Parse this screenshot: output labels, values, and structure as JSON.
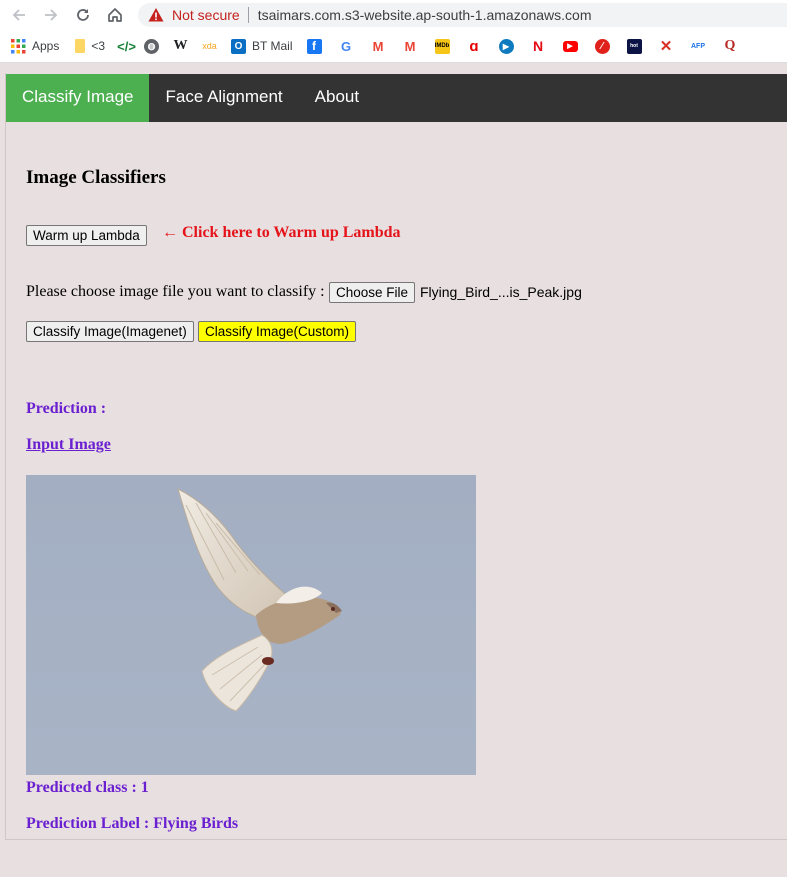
{
  "browser": {
    "security_label": "Not secure",
    "url": "tsaimars.com.s3-website.ap-south-1.amazonaws.com",
    "bookmarks": [
      {
        "label": "Apps",
        "icon": "apps-grid-icon"
      },
      {
        "label": "<3",
        "icon": "file-icon"
      },
      {
        "label": "",
        "icon": "code-icon"
      },
      {
        "label": "",
        "icon": "globe-icon"
      },
      {
        "label": "",
        "icon": "wikipedia-icon"
      },
      {
        "label": "",
        "icon": "xda-icon"
      },
      {
        "label": "BT Mail",
        "icon": "outlook-icon"
      },
      {
        "label": "",
        "icon": "facebook-icon"
      },
      {
        "label": "",
        "icon": "google-icon"
      },
      {
        "label": "",
        "icon": "gmail-icon"
      },
      {
        "label": "",
        "icon": "gmail-icon"
      },
      {
        "label": "",
        "icon": "imdb-icon"
      },
      {
        "label": "",
        "icon": "airtel-icon"
      },
      {
        "label": "",
        "icon": "play-icon"
      },
      {
        "label": "",
        "icon": "netflix-icon"
      },
      {
        "label": "",
        "icon": "youtube-icon"
      },
      {
        "label": "",
        "icon": "red-icon"
      },
      {
        "label": "",
        "icon": "hotstar-icon"
      },
      {
        "label": "",
        "icon": "cross-icon"
      },
      {
        "label": "",
        "icon": "afp-icon"
      },
      {
        "label": "",
        "icon": "quora-icon"
      }
    ]
  },
  "nav": {
    "items": [
      "Classify Image",
      "Face Alignment",
      "About"
    ],
    "active": "Classify Image"
  },
  "main": {
    "title": "Image Classifiers",
    "warm_button": "Warm up Lambda",
    "warm_hint": "← Click here to Warm up Lambda",
    "choose_label": "Please choose image file you want to classify :",
    "choose_button": "Choose File",
    "file_name": "Flying_Bird_...is_Peak.jpg",
    "classify_imagenet_button": "Classify Image(Imagenet)",
    "classify_custom_button": "Classify Image(Custom)",
    "prediction_label": "Prediction :",
    "input_image_link": "Input Image",
    "predicted_class": "Predicted class : 1",
    "prediction_label_text": "Prediction Label : Flying Birds"
  },
  "colors": {
    "nav_bg": "#333333",
    "nav_active": "#4caf50",
    "page_bg": "#e8dfe0",
    "hint_red": "#e5141a",
    "result_purple": "#6a1fd0",
    "custom_button": "#ffff00"
  }
}
